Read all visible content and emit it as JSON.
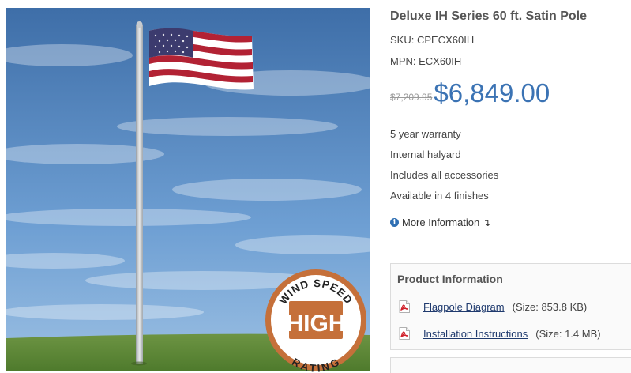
{
  "product": {
    "title": "Deluxe IH Series 60 ft. Satin Pole",
    "sku": "SKU: CPECX60IH",
    "mpn": "MPN: ECX60IH",
    "old_price": "$7,209.95",
    "price": "$6,849.00",
    "features": [
      "5 year warranty",
      "Internal halyard",
      "Includes all accessories",
      "Available in 4 finishes"
    ],
    "more_info_label": "More Information"
  },
  "badge": {
    "top_text": "WIND SPEED",
    "center_text": "HIGH",
    "bottom_text": "RATING",
    "ring_color": "#c5703a",
    "center_color": "#c5703a"
  },
  "product_information": {
    "title": "Product Information",
    "documents": [
      {
        "label": "Flagpole Diagram",
        "size": "(Size: 853.8 KB)",
        "icon": "pdf-icon"
      },
      {
        "label": "Installation Instructions",
        "size": "(Size: 1.4 MB)",
        "icon": "pdf-icon"
      }
    ]
  },
  "colors": {
    "price": "#3b73b4",
    "link": "#1f3a6e",
    "sky_top": "#3e6ea8",
    "grass": "#5f8a36"
  }
}
